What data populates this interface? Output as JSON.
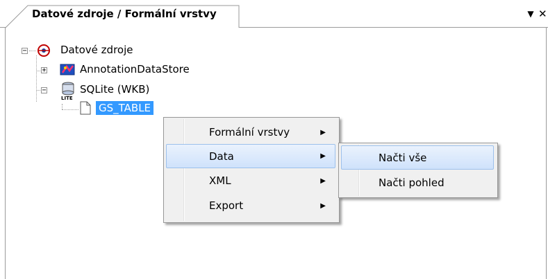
{
  "panel": {
    "tab_title": "Datové zdroje / Formální vrstvy",
    "dropdown_glyph": "▼",
    "close_glyph": "✕"
  },
  "tree": {
    "root": {
      "label": "Datové zdroje",
      "icon": "datasource-root-icon",
      "expanded": true
    },
    "children": [
      {
        "label": "AnnotationDataStore",
        "icon": "annotation-store-icon",
        "expanded": false
      },
      {
        "label": "SQLite (WKB)",
        "icon": "sqlite-database-icon",
        "expanded": true,
        "children": [
          {
            "label": "GS_TABLE",
            "icon": "document-icon",
            "selected": true
          }
        ]
      }
    ]
  },
  "context_menu": {
    "items": [
      {
        "label": "Formální vrstvy",
        "submenu": true,
        "highlighted": false
      },
      {
        "label": "Data",
        "submenu": true,
        "highlighted": true
      },
      {
        "label": "XML",
        "submenu": true,
        "highlighted": false
      },
      {
        "label": "Export",
        "submenu": true,
        "highlighted": false
      }
    ]
  },
  "submenu": {
    "items": [
      {
        "label": "Načti vše",
        "highlighted": true
      },
      {
        "label": "Načti pohled",
        "highlighted": false
      }
    ]
  },
  "colors": {
    "selection": "#3399ff",
    "menu_bg": "#f0f0f0",
    "menu_highlight_border": "#9cc0ec"
  }
}
